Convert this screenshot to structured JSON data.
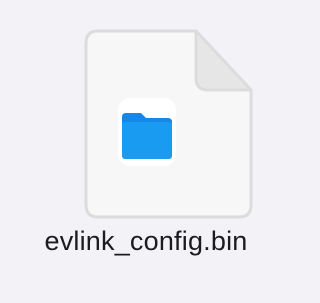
{
  "file": {
    "name": "evlink_config.bin",
    "icon": "generic-document-icon",
    "badge_icon": "folder-icon"
  },
  "colors": {
    "background": "#f2f2f7",
    "page_fill": "#f7f7f7",
    "page_stroke": "#dcdcdc",
    "folder_blue": "#1a9bf2",
    "text": "#1c1c1e"
  }
}
